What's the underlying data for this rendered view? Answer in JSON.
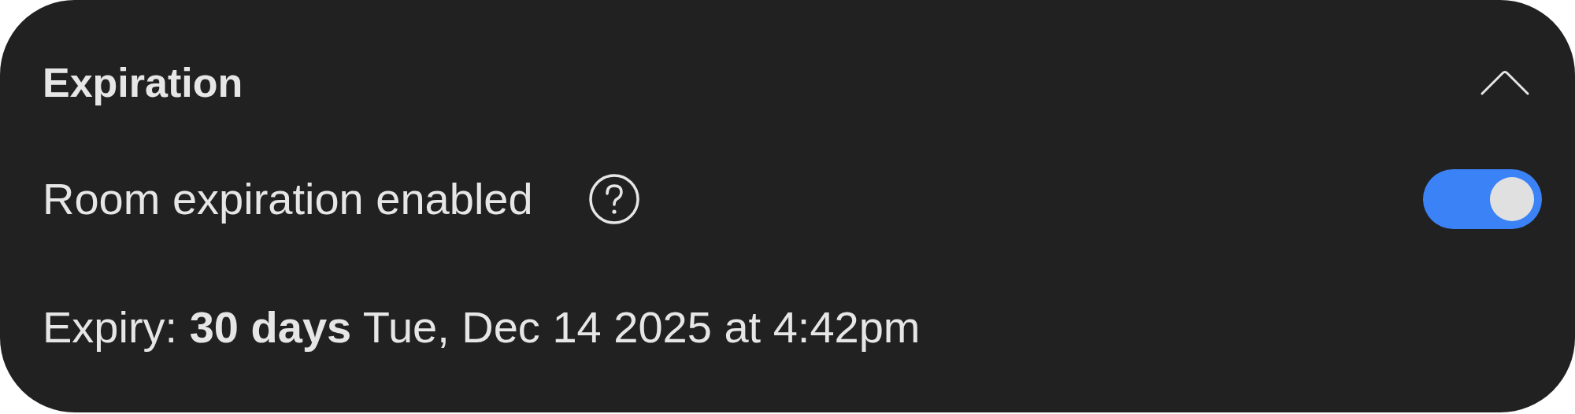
{
  "section": {
    "title": "Expiration",
    "expanded": true
  },
  "setting": {
    "label": "Room expiration enabled",
    "on": true
  },
  "expiry": "Expiry: **30 days** Tue, Dec 14 2025 at 4:42pm"
}
